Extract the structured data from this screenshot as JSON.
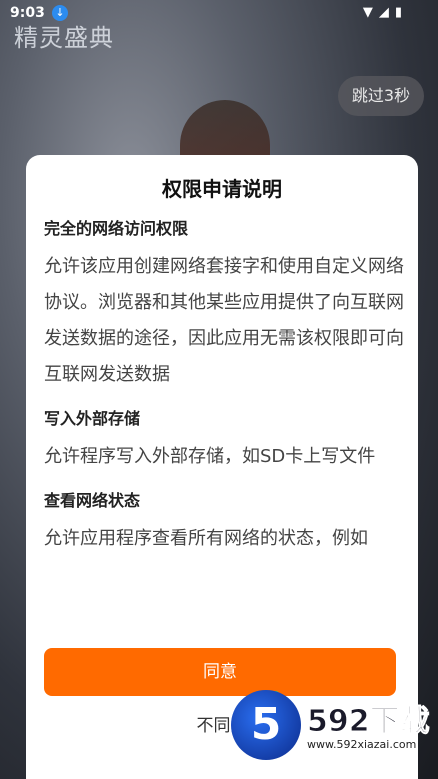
{
  "status_bar": {
    "time": "9:03"
  },
  "background": {
    "game_logo": "精灵盛典"
  },
  "skip_button": {
    "label": "跳过3秒"
  },
  "dialog": {
    "title": "权限申请说明",
    "permissions": [
      {
        "title": "完全的网络访问权限",
        "desc": "允许该应用创建网络套接字和使用自定义网络协议。浏览器和其他某些应用提供了向互联网发送数据的途径，因此应用无需该权限即可向互联网发送数据"
      },
      {
        "title": "写入外部存储",
        "desc": "允许程序写入外部存储，如SD卡上写文件"
      },
      {
        "title": "查看网络状态",
        "desc": "允许应用程序查看所有网络的状态，例如"
      }
    ],
    "agree_label": "同意",
    "disagree_label": "不同意"
  },
  "watermark": {
    "brand": "592下载",
    "url": "www.592xiazai.com",
    "logo_char": "5"
  },
  "colors": {
    "accent": "#ff6a00",
    "watermark_blue": "#2a6ef0"
  }
}
